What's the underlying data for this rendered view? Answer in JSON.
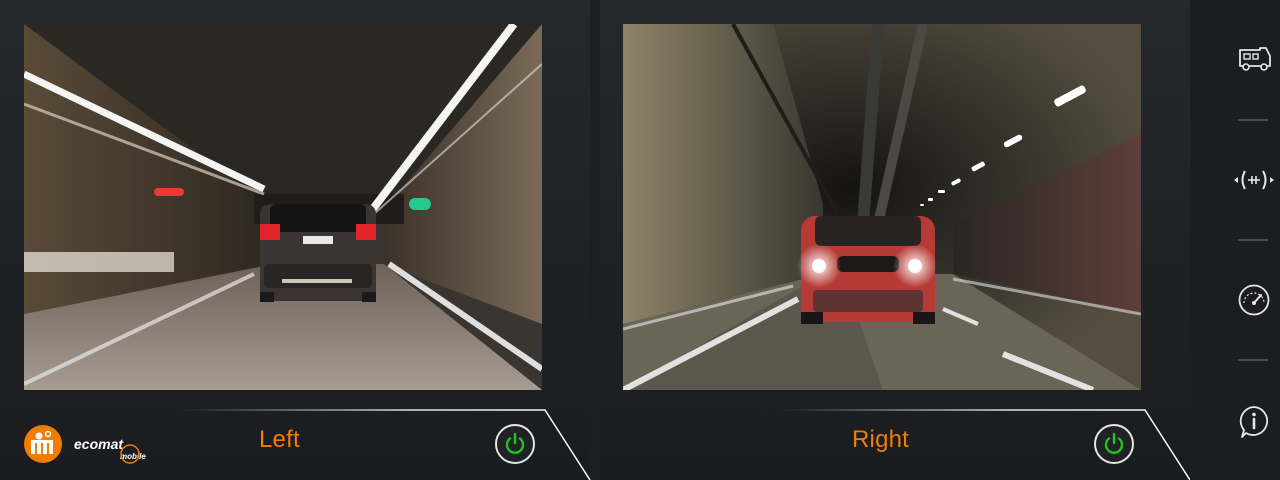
{
  "cameras": [
    {
      "label": "Left",
      "power_icon": "power-icon",
      "power_color": "#22c322"
    },
    {
      "label": "Right",
      "power_icon": "power-icon",
      "power_color": "#22c322"
    }
  ],
  "brand": {
    "logo_icon": "ifm-logo-icon",
    "logo_color": "#f07d00",
    "product_logo": "ecomat-mobile-logo",
    "product_lines": [
      "ecomat",
      "mobile"
    ]
  },
  "sidebar": {
    "items": [
      {
        "icon": "vehicle-icon"
      },
      {
        "icon": "camera-switch-icon"
      },
      {
        "icon": "speedometer-icon"
      },
      {
        "icon": "info-icon"
      }
    ]
  },
  "colors": {
    "accent": "#f07d00",
    "power_on": "#22c322",
    "icon": "#e6e6e6"
  }
}
